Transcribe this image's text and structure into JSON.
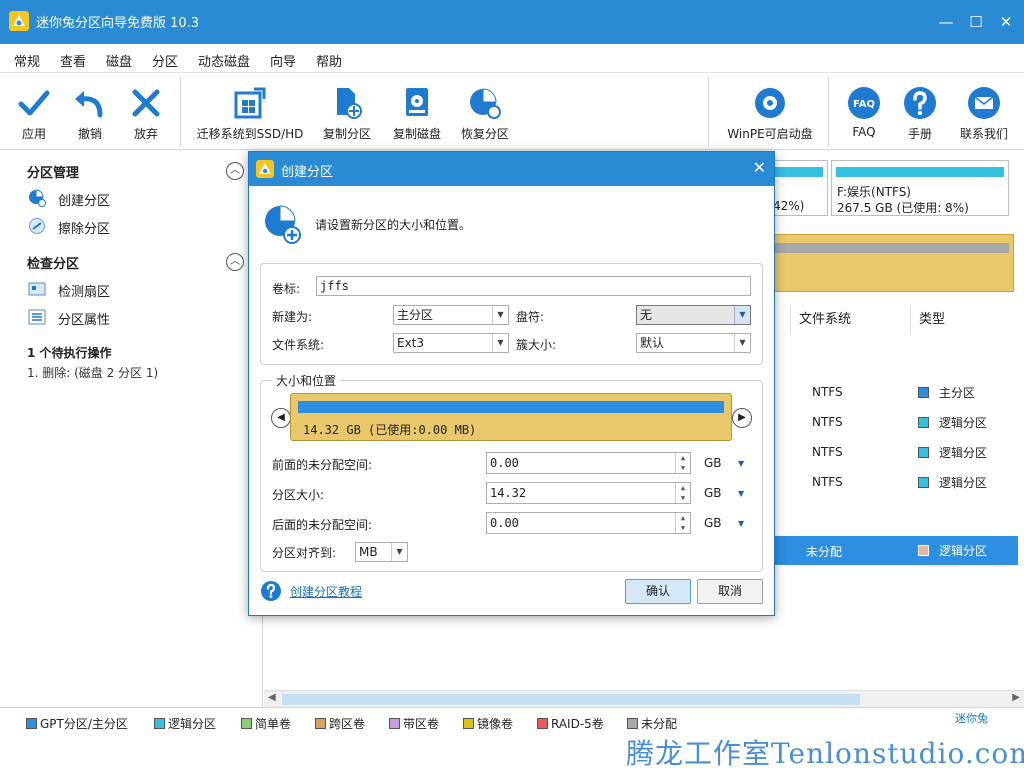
{
  "app": {
    "title": "迷你兔分区向导免费版 10.3",
    "brand": "迷你兔",
    "watermark": "腾龙工作室Tenlonstudio.com",
    "window_controls": {
      "min": "—",
      "max": "☐",
      "close": "✕"
    }
  },
  "menu": [
    "常规",
    "查看",
    "磁盘",
    "分区",
    "动态磁盘",
    "向导",
    "帮助"
  ],
  "toolbar": {
    "apply": "应用",
    "undo": "撤销",
    "discard": "放弃",
    "migrate": "迁移系统到SSD/HD",
    "copy_partition": "复制分区",
    "copy_disk": "复制磁盘",
    "recover_partition": "恢复分区",
    "winpe": "WinPE可启动盘",
    "faq": "FAQ",
    "manual": "手册",
    "contact": "联系我们"
  },
  "sidebar": {
    "section1_title": "分区管理",
    "section1_items": [
      "创建分区",
      "擦除分区"
    ],
    "section2_title": "检查分区",
    "section2_items": [
      "检测扇区",
      "分区属性"
    ],
    "pending_title": "1 个待执行操作",
    "pending_item": "1. 删除: (磁盘 2 分区 1)"
  },
  "disk_map": {
    "card1_usage": "42%)",
    "card2_label": "F:娱乐(NTFS)",
    "card2_detail": "267.5 GB (已使用: 8%)"
  },
  "table": {
    "headers": [
      "文件系统",
      "类型"
    ],
    "rows": [
      {
        "fs": "NTFS",
        "type": "主分区",
        "color": "#2e8ee0"
      },
      {
        "fs": "NTFS",
        "type": "逻辑分区",
        "color": "#35c0e0"
      },
      {
        "fs": "NTFS",
        "type": "逻辑分区",
        "color": "#35c0e0"
      },
      {
        "fs": "NTFS",
        "type": "逻辑分区",
        "color": "#35c0e0"
      },
      {
        "fs": "未分配",
        "type": "逻辑分区",
        "color": "#e0b8a0"
      }
    ]
  },
  "legend": [
    {
      "label": "GPT分区/主分区",
      "color": "#2e8ee0"
    },
    {
      "label": "逻辑分区",
      "color": "#35c0e0"
    },
    {
      "label": "简单卷",
      "color": "#8bcf7a"
    },
    {
      "label": "跨区卷",
      "color": "#d9a160"
    },
    {
      "label": "带区卷",
      "color": "#c79be0"
    },
    {
      "label": "镜像卷",
      "color": "#d9c21c"
    },
    {
      "label": "RAID-5卷",
      "color": "#e85a5a"
    },
    {
      "label": "未分配",
      "color": "#a8a8a8"
    }
  ],
  "dialog": {
    "title": "创建分区",
    "intro": "请设置新分区的大小和位置。",
    "label_volume": "卷标:",
    "volume_value": "jffs",
    "label_create_as": "新建为:",
    "create_as_value": "主分区",
    "label_drive_letter": "盘符:",
    "drive_letter_value": "无",
    "label_fs": "文件系统:",
    "fs_value": "Ext3",
    "label_cluster": "簇大小:",
    "cluster_value": "默认",
    "size_group_title": "大小和位置",
    "partition_block_text": "14.32 GB (已使用:0.00 MB)",
    "label_before": "前面的未分配空间:",
    "before_value": "0.00",
    "label_size": "分区大小:",
    "size_value": "14.32",
    "label_after": "后面的未分配空间:",
    "after_value": "0.00",
    "unit": "GB",
    "label_align": "分区对齐到:",
    "align_value": "MB",
    "help_link": "创建分区教程",
    "ok": "确认",
    "cancel": "取消"
  }
}
